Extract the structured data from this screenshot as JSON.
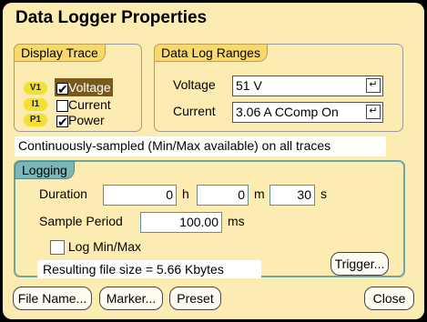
{
  "title": "Data Logger Properties",
  "display_trace": {
    "label": "Display Trace",
    "items": [
      {
        "badge": "V1",
        "label": "Voltage",
        "checked": true,
        "highlighted": true
      },
      {
        "badge": "I1",
        "label": "Current",
        "checked": false,
        "highlighted": false
      },
      {
        "badge": "P1",
        "label": "Power",
        "checked": true,
        "highlighted": false
      }
    ]
  },
  "data_log_ranges": {
    "label": "Data Log Ranges",
    "voltage_label": "Voltage",
    "voltage_value": "51 V",
    "current_label": "Current",
    "current_value": "3.06 A CComp On",
    "enter_glyph": "↵"
  },
  "sampling_info": "Continuously-sampled (Min/Max available)  on all traces",
  "logging": {
    "label": "Logging",
    "duration_label": "Duration",
    "hours": "0",
    "hours_unit": "h",
    "minutes": "0",
    "minutes_unit": "m",
    "seconds": "30",
    "seconds_unit": "s",
    "sample_period_label": "Sample Period",
    "sample_period": "100.00",
    "sample_period_unit": "ms",
    "log_minmax_label": "Log Min/Max",
    "log_minmax_checked": false,
    "file_size": "Resulting file size = 5.66 Kbytes",
    "trigger_button": "Trigger..."
  },
  "buttons": {
    "file_name": "File Name...",
    "marker": "Marker...",
    "preset": "Preset",
    "close": "Close"
  },
  "colors": {
    "background": "#fcecb2",
    "group_label": "#fad96b",
    "logging_border": "#6aa6a8",
    "badge": "#f4e030",
    "highlight": "#7a5a1a"
  }
}
